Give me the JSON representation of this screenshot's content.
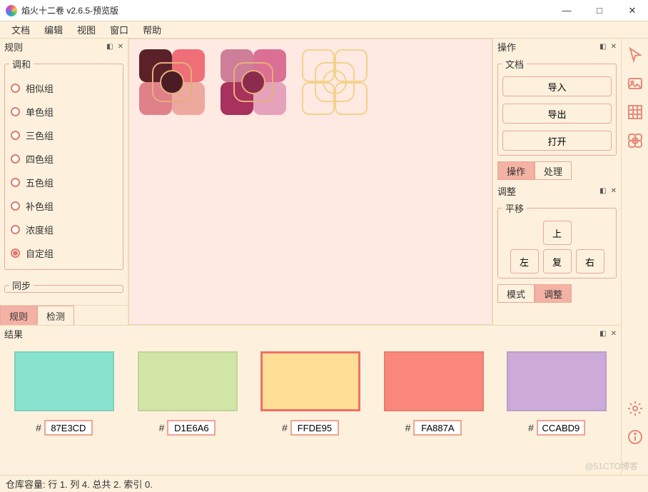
{
  "window": {
    "title": "焰火十二卷 v2.6.5-预览版"
  },
  "menu": {
    "file": "文档",
    "edit": "编辑",
    "view": "视图",
    "window": "窗口",
    "help": "帮助"
  },
  "left": {
    "title": "规则",
    "harmony_legend": "调和",
    "rules": [
      {
        "label": "相似组",
        "checked": false
      },
      {
        "label": "单色组",
        "checked": false
      },
      {
        "label": "三色组",
        "checked": false
      },
      {
        "label": "四色组",
        "checked": false
      },
      {
        "label": "五色组",
        "checked": false
      },
      {
        "label": "补色组",
        "checked": false
      },
      {
        "label": "浓度组",
        "checked": false
      },
      {
        "label": "自定组",
        "checked": true
      }
    ],
    "sync_legend": "同步",
    "tabs": {
      "rule": "规则",
      "detect": "检测",
      "active": "rule"
    }
  },
  "canvas": {
    "slots": [
      {
        "empty": false,
        "q": [
          "#5a2129",
          "#ef6f78",
          "#e0818a",
          "#eda8a0"
        ],
        "center": "#4a1d24"
      },
      {
        "empty": false,
        "q": [
          "#ce7e99",
          "#db7094",
          "#a8315d",
          "#e6a2bb"
        ],
        "center": "#8d2b4e"
      },
      {
        "empty": true
      }
    ]
  },
  "right": {
    "ops_title": "操作",
    "doc_legend": "文档",
    "buttons": {
      "import": "导入",
      "export": "导出",
      "open": "打开"
    },
    "ops_tabs": {
      "ops": "操作",
      "process": "处理",
      "active": "ops"
    },
    "adjust_title": "调整",
    "pan_legend": "平移",
    "arrows": {
      "up": "上",
      "left": "左",
      "reset": "复",
      "right": "右"
    },
    "adjust_tabs": {
      "mode": "模式",
      "adjust": "调整",
      "active": "adjust"
    }
  },
  "results": {
    "title": "结果",
    "swatches": [
      {
        "hex": "87E3CD",
        "color": "#87e3cd",
        "active": false
      },
      {
        "hex": "D1E6A6",
        "color": "#d1e6a6",
        "active": false
      },
      {
        "hex": "FFDE95",
        "color": "#ffde95",
        "active": true
      },
      {
        "hex": "FA887A",
        "color": "#fa887a",
        "active": false
      },
      {
        "hex": "CCABD9",
        "color": "#ccabd9",
        "active": false
      }
    ]
  },
  "status": "仓库容量: 行 1. 列 4. 总共 2. 索引 0.",
  "watermark": "@51CTO博客"
}
